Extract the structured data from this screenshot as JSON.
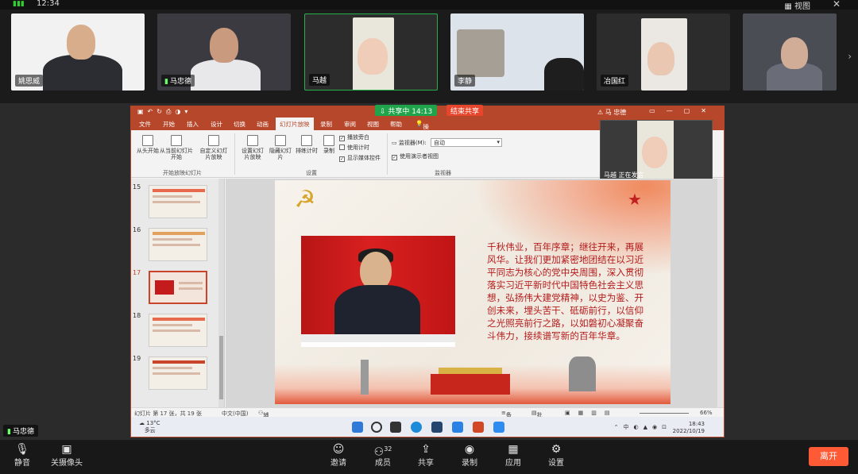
{
  "status": {
    "time": "12:34",
    "view_label": "视图"
  },
  "participants": [
    {
      "name": "姚思威",
      "active": false
    },
    {
      "name": "马忠德",
      "active": false
    },
    {
      "name": "马越",
      "active": true
    },
    {
      "name": "李静",
      "active": false
    },
    {
      "name": "冶国红",
      "active": false
    },
    {
      "name": "",
      "active": false
    }
  ],
  "share": {
    "status": "共享中 14:13",
    "end_label": "结束共享"
  },
  "ppt": {
    "title_user": "马 忠德",
    "tabs": [
      "文件",
      "开始",
      "插入",
      "设计",
      "切换",
      "动画",
      "幻灯片放映",
      "录制",
      "审阅",
      "视图",
      "帮助",
      "操作说明搜索"
    ],
    "active_tab": "幻灯片放映",
    "ribbon": {
      "from_start": "从头开始",
      "from_current": "从当前幻灯片开始",
      "custom": "自定义幻灯片放映",
      "group_start": "开始放映幻灯片",
      "setup": "设置幻灯片放映",
      "hide": "隐藏幻灯片",
      "rehearse": "排练计时",
      "record": "录制",
      "group_setup": "设置",
      "chk_narration": "播放旁白",
      "chk_timing": "使用计时",
      "chk_media": "显示媒体控件",
      "monitor_label": "监视器(M):",
      "monitor_value": "自动",
      "presenter_view": "使用演示者视图",
      "group_monitor": "监视器"
    },
    "pip_label": "马越 正在发言",
    "slide_numbers": [
      "15",
      "16",
      "17",
      "18",
      "19"
    ],
    "selected_slide": "17",
    "slide_text": "千秋伟业，百年序章；继往开来，再展风华。让我们更加紧密地团结在以习近平同志为核心的党中央周围，深入贯彻落实习近平新时代中国特色社会主义思想，弘扬伟大建党精神，以史为鉴、开创未来，埋头苦干、砥砺前行，以信仰之光照亮前行之路，以如磐初心凝聚奋斗伟力，接续谱写新的百年华章。",
    "statusbar": {
      "slide_info": "幻灯片 第 17 张，共 19 张",
      "language": "中文(中国)",
      "accessibility": "辅助功能: 调查",
      "notes": "备注",
      "comments": "批注",
      "zoom": "66%"
    }
  },
  "taskbar": {
    "temp": "13°C",
    "weather": "多云",
    "clock_time": "18:43",
    "clock_date": "2022/10/19"
  },
  "speaker_tag": "马忠德",
  "controls": [
    {
      "label": "静音",
      "icon": "mic-icon"
    },
    {
      "label": "关摄像头",
      "icon": "camera-icon"
    },
    {
      "label": "邀请",
      "icon": "invite-icon"
    },
    {
      "label": "成员",
      "icon": "members-icon",
      "count": "32"
    },
    {
      "label": "共享",
      "icon": "share-icon"
    },
    {
      "label": "录制",
      "icon": "record-icon"
    },
    {
      "label": "应用",
      "icon": "apps-icon"
    },
    {
      "label": "设置",
      "icon": "settings-icon"
    }
  ],
  "leave_label": "离开"
}
